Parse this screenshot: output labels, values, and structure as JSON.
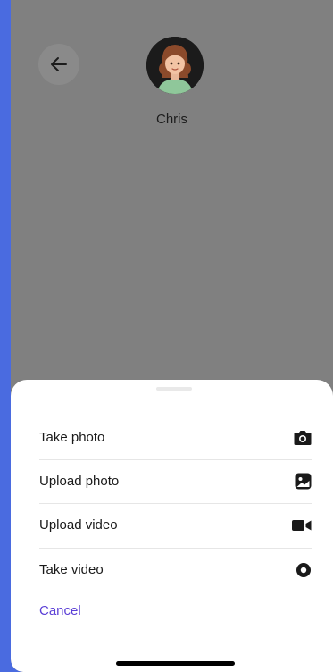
{
  "contact": {
    "name": "Chris"
  },
  "sheet": {
    "options": [
      {
        "label": "Take photo",
        "icon": "camera-icon"
      },
      {
        "label": "Upload photo",
        "icon": "image-icon"
      },
      {
        "label": "Upload video",
        "icon": "video-camera-icon"
      },
      {
        "label": "Take video",
        "icon": "record-icon"
      }
    ],
    "cancel_label": "Cancel"
  },
  "colors": {
    "overlay": "#808080",
    "accent": "#5b3fd6",
    "sheet_background": "#ffffff",
    "frame": "#4a6be0"
  }
}
